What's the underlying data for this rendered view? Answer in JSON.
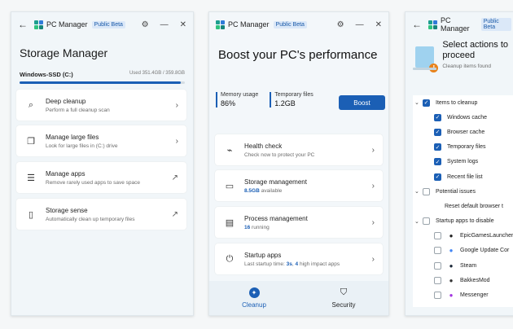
{
  "app": {
    "name": "PC Manager",
    "badge": "Public Beta"
  },
  "storage": {
    "title": "Storage Manager",
    "drive_label": "Windows-SSD (C:)",
    "used": "Used 351.4GB / 359.8GB",
    "used_fraction": 0.977,
    "items": [
      {
        "title": "Deep cleanup",
        "subtitle": "Perform a full cleanup scan",
        "icon": "broom-icon"
      },
      {
        "title": "Manage large files",
        "subtitle": "Look for large files in (C:) drive",
        "icon": "files-icon"
      },
      {
        "title": "Manage apps",
        "subtitle": "Remove rarely used apps to save space",
        "icon": "apps-list-icon"
      },
      {
        "title": "Storage sense",
        "subtitle": "Automatically clean up temporary files",
        "icon": "storage-sense-icon"
      }
    ]
  },
  "boost": {
    "title": "Boost your PC's performance",
    "memory_label": "Memory usage",
    "memory_value": "86%",
    "temp_label": "Temporary files",
    "temp_value": "1.2GB",
    "button": "Boost",
    "items": [
      {
        "title": "Health check",
        "sub": "Check now to protect your PC",
        "icon": "health-monitor-icon"
      },
      {
        "title": "Storage management",
        "hl": "8.5GB",
        "sub": " available",
        "icon": "storage-drive-icon"
      },
      {
        "title": "Process management",
        "hl": "16",
        "sub": " running",
        "icon": "process-icon"
      },
      {
        "title": "Startup apps",
        "pre": "Last startup time: ",
        "hl": "3s",
        "mid": ", ",
        "hl2": "4",
        "sub": " high impact apps",
        "icon": "power-icon"
      }
    ],
    "nav": [
      {
        "label": "Cleanup",
        "icon": "cleanup-icon"
      },
      {
        "label": "Security",
        "icon": "shield-icon"
      }
    ]
  },
  "cleanup": {
    "title": "Select actions to proceed",
    "subtitle": "Cleanup items found",
    "rows": [
      {
        "type": "group",
        "label": "Items to cleanup",
        "checked": true,
        "chev": "⌄"
      },
      {
        "type": "item",
        "label": "Windows cache",
        "checked": true
      },
      {
        "type": "item",
        "label": "Browser cache",
        "checked": true
      },
      {
        "type": "item",
        "label": "Temporary files",
        "checked": true
      },
      {
        "type": "item",
        "label": "System logs",
        "checked": true
      },
      {
        "type": "item",
        "label": "Recent file list",
        "checked": true
      },
      {
        "type": "group",
        "label": "Potential issues",
        "checked": false,
        "chev": "⌄"
      },
      {
        "type": "plain",
        "label": "Reset default browser t"
      },
      {
        "type": "group",
        "label": "Startup apps to disable",
        "checked": false,
        "chev": "⌄"
      },
      {
        "type": "app",
        "label": "EpicGamesLauncher",
        "checked": false,
        "icon": "epic-games-icon",
        "color": "#222222"
      },
      {
        "type": "app",
        "label": "Google Update Cor",
        "checked": false,
        "icon": "google-update-icon",
        "color": "#4285f4"
      },
      {
        "type": "app",
        "label": "Steam",
        "checked": false,
        "icon": "steam-icon",
        "color": "#1b2838"
      },
      {
        "type": "app",
        "label": "BakkesMod",
        "checked": false,
        "icon": "bakkesmod-icon",
        "color": "#333333"
      },
      {
        "type": "app",
        "label": "Messenger",
        "checked": false,
        "icon": "messenger-icon",
        "color": "#a234e0"
      }
    ]
  }
}
